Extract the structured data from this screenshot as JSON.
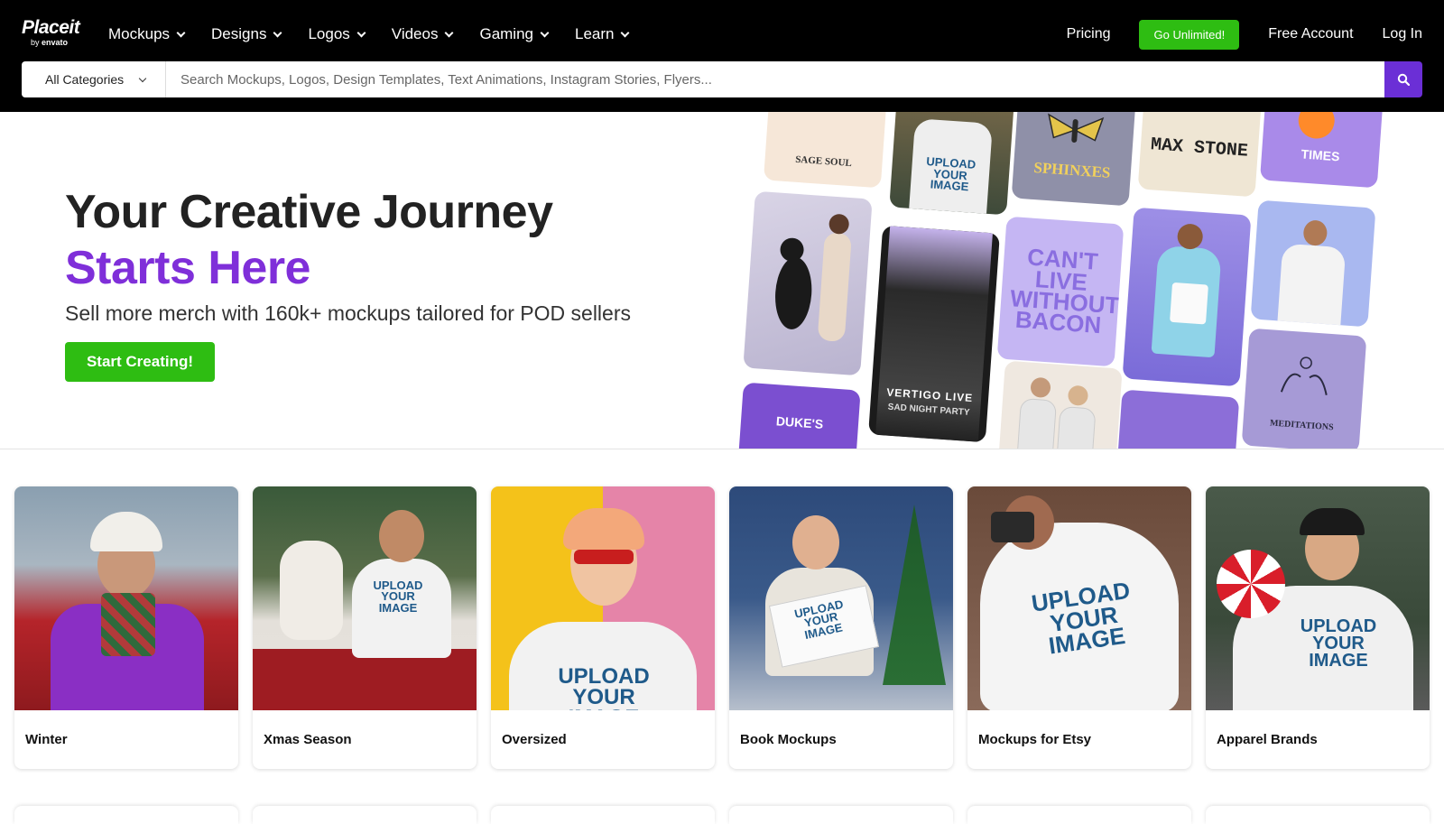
{
  "brand": {
    "name": "Placeit",
    "sub_by": "by",
    "sub_brand": "envato"
  },
  "nav": [
    {
      "label": "Mockups"
    },
    {
      "label": "Designs"
    },
    {
      "label": "Logos"
    },
    {
      "label": "Videos"
    },
    {
      "label": "Gaming"
    },
    {
      "label": "Learn"
    }
  ],
  "header": {
    "pricing": "Pricing",
    "unlimited": "Go Unlimited!",
    "free_account": "Free Account",
    "login": "Log In"
  },
  "search": {
    "category": "All Categories",
    "placeholder": "Search Mockups, Logos, Design Templates, Text Animations, Instagram Stories, Flyers..."
  },
  "hero": {
    "title": "Your Creative Journey",
    "title_accent": "Starts Here",
    "subtitle": "Sell more merch with 160k+ mockups tailored for POD sellers",
    "cta": "Start Creating!"
  },
  "collage_text": {
    "sage": "SAGE SOUL",
    "sphinxes": "SPHINXES",
    "max_stone": "MAX STONE",
    "times": "TIMES",
    "bacon": "CAN'T LIVE WITHOUT BACON",
    "vertigo": "VERTIGO LIVE",
    "sad_night": "SAD NIGHT PARTY",
    "meditations": "MEDITATIONS",
    "dukes": "DUKE'S",
    "upload": "UPLOAD YOUR IMAGE"
  },
  "categories": [
    {
      "label": "Winter"
    },
    {
      "label": "Xmas Season"
    },
    {
      "label": "Oversized"
    },
    {
      "label": "Book Mockups"
    },
    {
      "label": "Mockups for Etsy"
    },
    {
      "label": "Apparel Brands"
    }
  ],
  "colors": {
    "accent": "#7f2fd9",
    "cta": "#2ebd12",
    "search_button": "#6b2fd6",
    "header_bg": "#000000"
  }
}
